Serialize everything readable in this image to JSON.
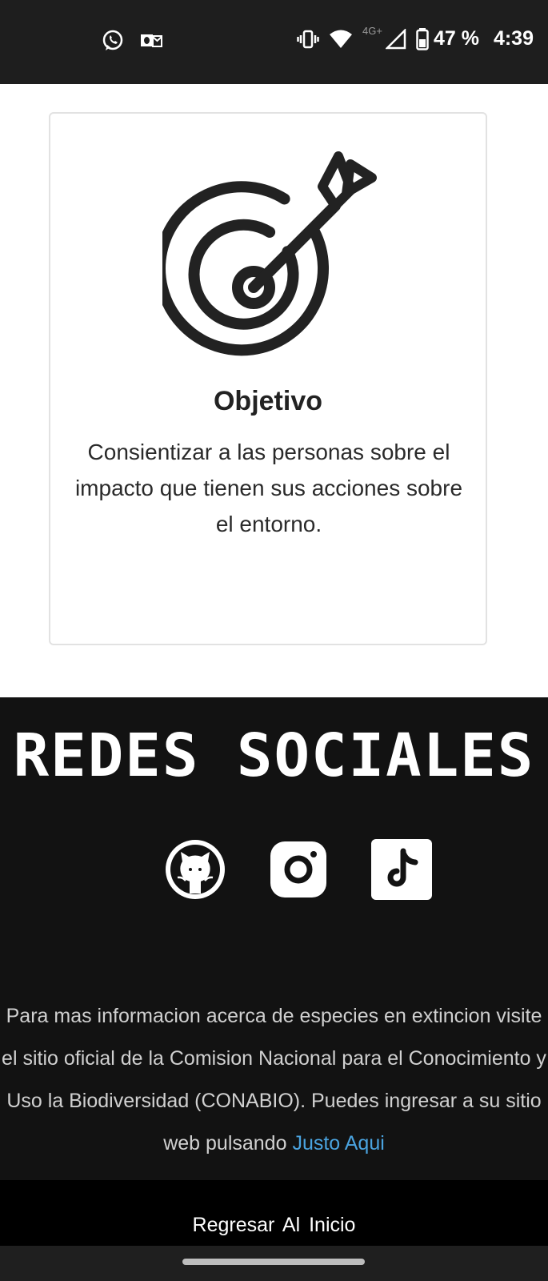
{
  "status_bar": {
    "network_label": "4G+",
    "battery": "47 %",
    "time": "4:39",
    "icons": [
      "whatsapp-icon",
      "outlook-icon",
      "vibrate-icon",
      "wifi-icon",
      "signal-icon",
      "battery-icon"
    ]
  },
  "card": {
    "icon": "target-arrow-icon",
    "title": "Objetivo",
    "description": "Consientizar a las personas sobre el impacto que tienen sus acciones sobre el entorno."
  },
  "footer": {
    "heading": "REDES SOCIALES",
    "social_links": [
      "github-icon",
      "instagram-icon",
      "tiktok-icon"
    ],
    "info_text": "Para mas informacion acerca de especies en extincion visite el sitio oficial de la Comision Nacional para el Conocimiento y Uso la Biodiversidad (CONABIO). Puedes ingresar a su sitio web pulsando ",
    "info_link": "Justo Aqui",
    "link_color": "#4aa3df"
  },
  "bottom": {
    "home_link": "Regresar Al Inicio"
  }
}
